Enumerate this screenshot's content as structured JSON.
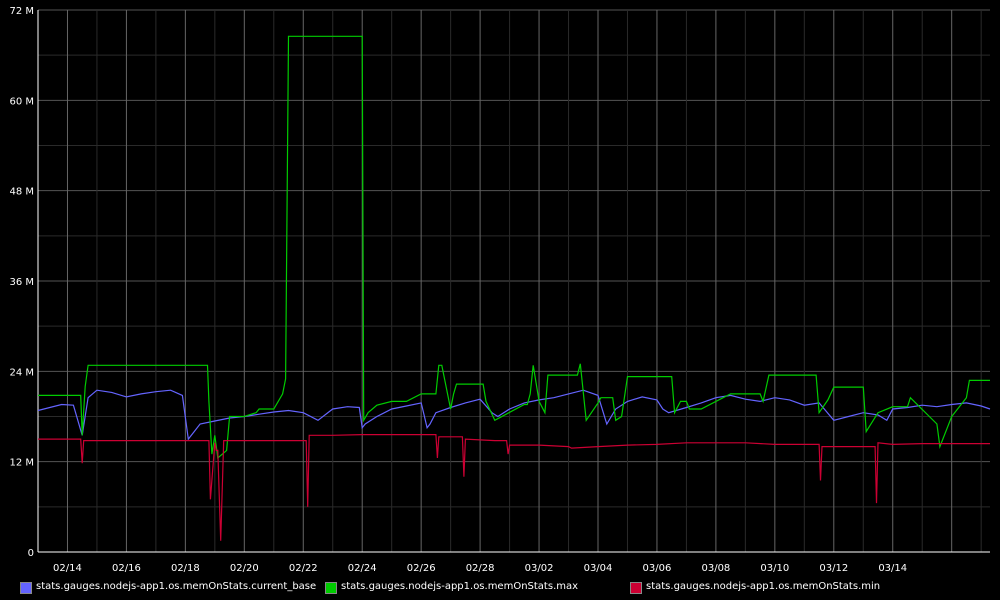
{
  "chart_data": {
    "type": "line",
    "title": "",
    "xlabel": "",
    "ylabel": "",
    "ylim": [
      0,
      72000000
    ],
    "y_ticks": [
      {
        "value": 0,
        "label": "0"
      },
      {
        "value": 12000000,
        "label": "12 M"
      },
      {
        "value": 24000000,
        "label": "24 M"
      },
      {
        "value": 36000000,
        "label": "36 M"
      },
      {
        "value": 48000000,
        "label": "48 M"
      },
      {
        "value": 60000000,
        "label": "60 M"
      },
      {
        "value": 72000000,
        "label": "72 M"
      }
    ],
    "x_ticks": [
      "02/14",
      "02/16",
      "02/18",
      "02/20",
      "02/22",
      "02/24",
      "02/26",
      "02/28",
      "03/02",
      "03/04",
      "03/06",
      "03/08",
      "03/10",
      "03/12",
      "03/14"
    ],
    "xlim_days": [
      0,
      32.3
    ],
    "x_tick_offset_days": 1,
    "background": "#000000",
    "grid": true,
    "grid_color": "#333333",
    "legend_position": "bottom",
    "series": [
      {
        "name": "stats.gauges.nodejs-app1.os.memOnStats.current_base",
        "color": "#6464ff",
        "x": [
          0.0,
          0.4,
          0.8,
          1.2,
          1.5,
          1.7,
          2.0,
          2.5,
          3.0,
          3.5,
          4.0,
          4.5,
          4.9,
          5.1,
          5.3,
          5.5,
          6.0,
          6.5,
          7.0,
          7.5,
          8.0,
          8.5,
          9.0,
          9.5,
          10.0,
          10.5,
          10.9,
          11.0,
          11.1,
          11.5,
          12.0,
          12.5,
          13.0,
          13.2,
          13.3,
          13.5,
          14.0,
          14.5,
          15.0,
          15.4,
          15.6,
          16.0,
          16.5,
          17.0,
          17.5,
          18.0,
          18.5,
          19.0,
          19.3,
          19.6,
          20.0,
          20.5,
          21.0,
          21.2,
          21.4,
          22.0,
          22.5,
          23.0,
          23.5,
          24.0,
          24.5,
          25.0,
          25.5,
          26.0,
          26.5,
          27.0,
          27.5,
          28.0,
          28.5,
          28.8,
          29.0,
          29.5,
          30.0,
          30.5,
          31.0,
          31.5,
          32.0,
          32.3
        ],
        "values": [
          18.8,
          19.2,
          19.6,
          19.5,
          15.5,
          20.5,
          21.5,
          21.2,
          20.6,
          21.0,
          21.3,
          21.5,
          20.8,
          15.0,
          16.0,
          17.0,
          17.4,
          17.8,
          18.0,
          18.3,
          18.6,
          18.8,
          18.5,
          17.5,
          19.0,
          19.3,
          19.2,
          16.5,
          17.0,
          18.0,
          19.0,
          19.4,
          19.8,
          16.5,
          17.0,
          18.5,
          19.2,
          19.8,
          20.3,
          18.5,
          18.0,
          19.0,
          19.8,
          20.2,
          20.5,
          21.0,
          21.5,
          20.8,
          17.0,
          19.0,
          20.0,
          20.6,
          20.2,
          19.0,
          18.5,
          19.2,
          19.8,
          20.5,
          20.8,
          20.3,
          20.0,
          20.5,
          20.2,
          19.5,
          19.8,
          17.5,
          18.0,
          18.5,
          18.2,
          17.5,
          19.0,
          19.2,
          19.5,
          19.3,
          19.6,
          19.8,
          19.4,
          19.0
        ]
      },
      {
        "name": "stats.gauges.nodejs-app1.os.memOnStats.max",
        "color": "#00cc00",
        "x": [
          0.0,
          1.45,
          1.5,
          1.6,
          1.7,
          5.75,
          5.8,
          5.9,
          6.0,
          6.1,
          6.4,
          6.5,
          7.0,
          7.4,
          7.5,
          8.0,
          8.3,
          8.4,
          8.5,
          9.0,
          11.0,
          11.05,
          11.2,
          11.5,
          12.0,
          12.5,
          13.0,
          13.1,
          13.2,
          13.5,
          13.6,
          13.7,
          14.0,
          14.1,
          14.2,
          15.1,
          15.2,
          15.5,
          16.5,
          16.6,
          16.7,
          16.8,
          17.0,
          17.2,
          17.3,
          18.3,
          18.4,
          18.6,
          19.0,
          19.1,
          19.4,
          19.5,
          19.6,
          19.8,
          20.0,
          21.5,
          21.6,
          21.8,
          22.0,
          22.1,
          22.5,
          23.5,
          24.5,
          24.6,
          24.8,
          25.0,
          26.4,
          26.5,
          26.8,
          27.0,
          28.0,
          28.1,
          28.5,
          29.0,
          29.5,
          29.6,
          30.5,
          30.6,
          31.0,
          31.5,
          31.6,
          32.3
        ],
        "values": [
          20.8,
          20.8,
          15.5,
          22.0,
          24.8,
          24.8,
          20.0,
          13.0,
          15.5,
          12.5,
          13.5,
          18.0,
          18.0,
          18.5,
          19.0,
          19.0,
          21.0,
          23.0,
          68.5,
          68.5,
          68.5,
          17.5,
          18.5,
          19.5,
          20.0,
          20.0,
          21.0,
          21.0,
          21.0,
          21.0,
          24.8,
          24.8,
          19.0,
          21.0,
          22.3,
          22.3,
          20.0,
          17.5,
          19.6,
          19.6,
          21.0,
          24.8,
          20.0,
          18.5,
          23.5,
          23.5,
          25.0,
          17.5,
          19.8,
          20.5,
          20.5,
          20.5,
          17.5,
          18.0,
          23.3,
          23.3,
          18.5,
          20.0,
          20.0,
          19.0,
          19.0,
          21.0,
          21.0,
          20.0,
          23.5,
          23.5,
          23.5,
          18.5,
          20.2,
          21.9,
          21.9,
          16.0,
          18.5,
          19.3,
          19.3,
          20.5,
          17.0,
          14.0,
          18.0,
          20.5,
          22.8,
          22.8
        ]
      },
      {
        "name": "stats.gauges.nodejs-app1.os.memOnStats.min",
        "color": "#cc0033",
        "x": [
          0.0,
          1.45,
          1.5,
          1.55,
          1.7,
          5.75,
          5.8,
          5.85,
          6.0,
          6.05,
          6.1,
          6.2,
          6.3,
          6.5,
          8.0,
          9.0,
          9.1,
          9.15,
          9.2,
          10.0,
          11.0,
          11.05,
          13.0,
          13.5,
          13.55,
          13.6,
          14.0,
          14.4,
          14.45,
          14.5,
          15.5,
          15.9,
          15.95,
          16.0,
          16.1,
          17.0,
          18.0,
          18.1,
          19.0,
          20.0,
          21.0,
          22.0,
          22.5,
          22.55,
          22.6,
          23.0,
          24.0,
          25.0,
          26.5,
          26.55,
          26.6,
          27.0,
          28.0,
          28.4,
          28.45,
          28.5,
          29.0,
          30.0,
          32.3
        ],
        "values": [
          15.0,
          15.0,
          11.8,
          14.8,
          14.8,
          14.8,
          14.8,
          7.0,
          14.5,
          13.5,
          13.5,
          1.5,
          14.8,
          14.8,
          14.8,
          14.8,
          14.8,
          6.0,
          15.5,
          15.5,
          15.6,
          15.6,
          15.6,
          15.6,
          12.5,
          15.3,
          15.3,
          15.3,
          10.0,
          15.0,
          14.8,
          14.8,
          13.0,
          14.2,
          14.2,
          14.2,
          14.0,
          13.8,
          14.0,
          14.2,
          14.3,
          14.5,
          14.5,
          14.5,
          14.5,
          14.5,
          14.5,
          14.3,
          14.3,
          9.5,
          14.0,
          14.0,
          14.0,
          14.0,
          6.5,
          14.5,
          14.3,
          14.4,
          14.4
        ]
      }
    ]
  }
}
